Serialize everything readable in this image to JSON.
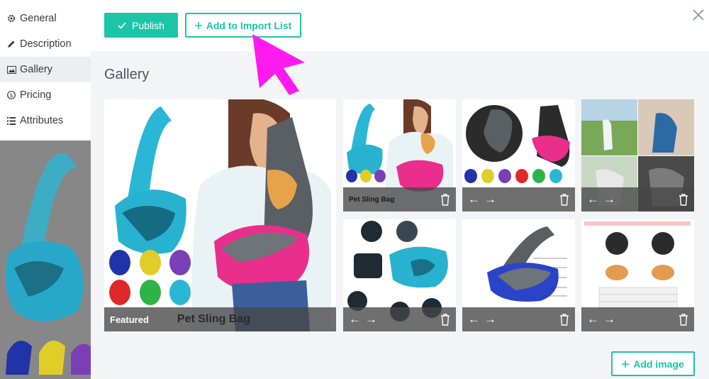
{
  "sidebar": {
    "items": [
      {
        "label": "General",
        "icon": "gear-icon"
      },
      {
        "label": "Description",
        "icon": "pencil-icon"
      },
      {
        "label": "Gallery",
        "icon": "image-icon"
      },
      {
        "label": "Pricing",
        "icon": "dollar-circle-icon"
      },
      {
        "label": "Attributes",
        "icon": "list-icon"
      }
    ],
    "active": "Gallery"
  },
  "toolbar": {
    "publish_label": "Publish",
    "import_label": "Add to Import List"
  },
  "gallery": {
    "title": "Gallery",
    "featured_label": "Featured",
    "move_arrows": "←→",
    "add_image_label": "Add image",
    "tiles": [
      {
        "name": "featured",
        "caption": "Pet Sling Bag"
      },
      {
        "name": "image-2",
        "caption": "Pet Sling Bag"
      },
      {
        "name": "image-3",
        "caption": ""
      },
      {
        "name": "image-4",
        "caption": ""
      },
      {
        "name": "image-5",
        "caption": ""
      },
      {
        "name": "image-6",
        "caption": ""
      },
      {
        "name": "image-7",
        "caption": ""
      }
    ]
  },
  "colors": {
    "accent": "#1cc5a8",
    "pointer": "#ff1aee",
    "camo_blue": "#2ab7d6",
    "sling_pink": "#ea2e8c",
    "sling_gray": "#5a5f63"
  }
}
